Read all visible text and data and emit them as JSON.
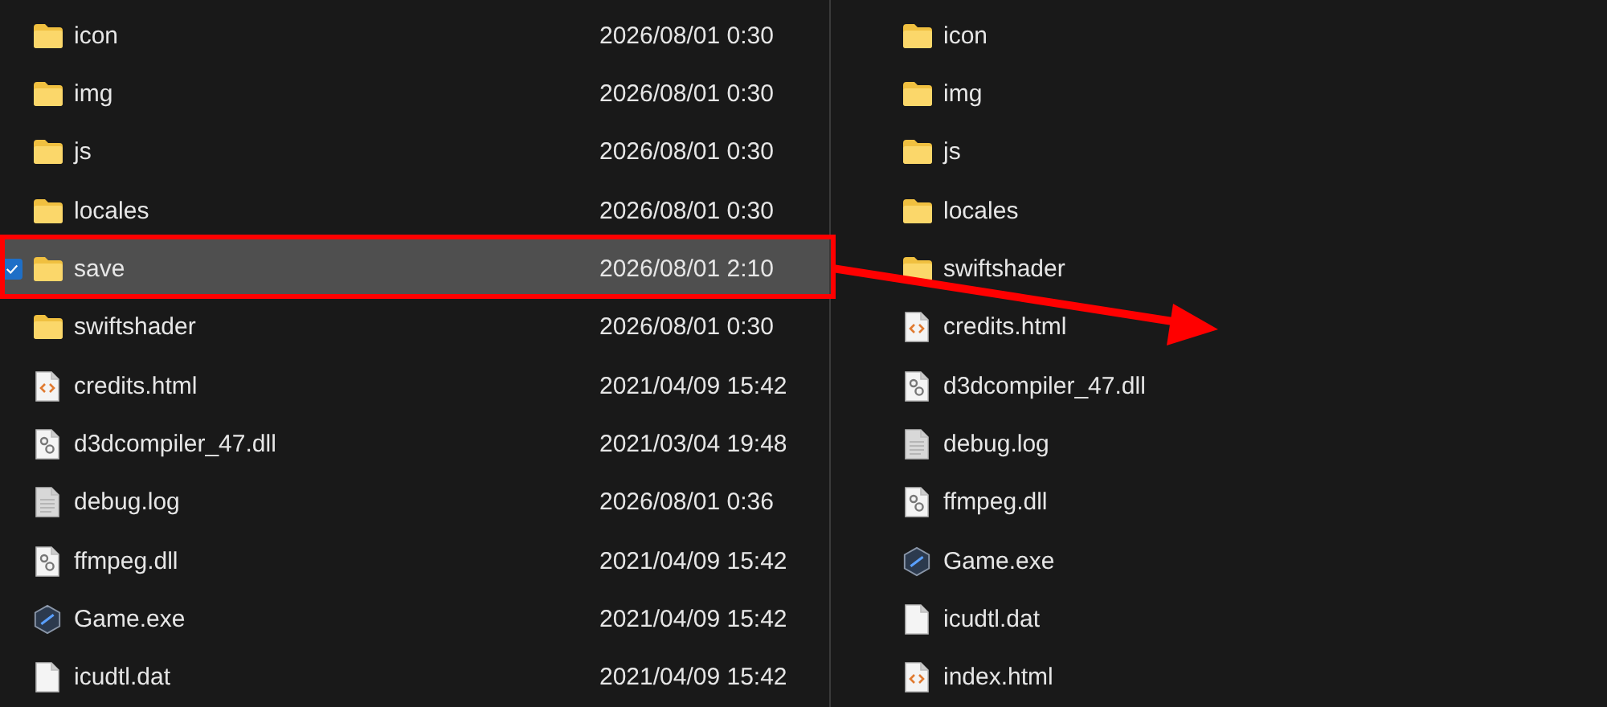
{
  "left_pane": {
    "files": [
      {
        "name": "icon",
        "kind": "folder",
        "modified": "2026/08/01 0:30",
        "selected": false
      },
      {
        "name": "img",
        "kind": "folder",
        "modified": "2026/08/01 0:30",
        "selected": false
      },
      {
        "name": "js",
        "kind": "folder",
        "modified": "2026/08/01 0:30",
        "selected": false
      },
      {
        "name": "locales",
        "kind": "folder",
        "modified": "2026/08/01 0:30",
        "selected": false
      },
      {
        "name": "save",
        "kind": "folder",
        "modified": "2026/08/01 2:10",
        "selected": true
      },
      {
        "name": "swiftshader",
        "kind": "folder",
        "modified": "2026/08/01 0:30",
        "selected": false
      },
      {
        "name": "credits.html",
        "kind": "html",
        "modified": "2021/04/09 15:42",
        "selected": false
      },
      {
        "name": "d3dcompiler_47.dll",
        "kind": "dll",
        "modified": "2021/03/04 19:48",
        "selected": false
      },
      {
        "name": "debug.log",
        "kind": "log",
        "modified": "2026/08/01 0:36",
        "selected": false
      },
      {
        "name": "ffmpeg.dll",
        "kind": "dll",
        "modified": "2021/04/09 15:42",
        "selected": false
      },
      {
        "name": "Game.exe",
        "kind": "exe",
        "modified": "2021/04/09 15:42",
        "selected": false
      },
      {
        "name": "icudtl.dat",
        "kind": "dat",
        "modified": "2021/04/09 15:42",
        "selected": false
      }
    ]
  },
  "right_pane": {
    "files": [
      {
        "name": "icon",
        "kind": "folder",
        "selected": false
      },
      {
        "name": "img",
        "kind": "folder",
        "selected": false
      },
      {
        "name": "js",
        "kind": "folder",
        "selected": false
      },
      {
        "name": "locales",
        "kind": "folder",
        "selected": false
      },
      {
        "name": "swiftshader",
        "kind": "folder",
        "selected": false
      },
      {
        "name": "credits.html",
        "kind": "html",
        "selected": false
      },
      {
        "name": "d3dcompiler_47.dll",
        "kind": "dll",
        "selected": false
      },
      {
        "name": "debug.log",
        "kind": "log",
        "selected": false
      },
      {
        "name": "ffmpeg.dll",
        "kind": "dll",
        "selected": false
      },
      {
        "name": "Game.exe",
        "kind": "exe",
        "selected": false
      },
      {
        "name": "icudtl.dat",
        "kind": "dat",
        "selected": false
      },
      {
        "name": "index.html",
        "kind": "html",
        "selected": false
      }
    ]
  }
}
